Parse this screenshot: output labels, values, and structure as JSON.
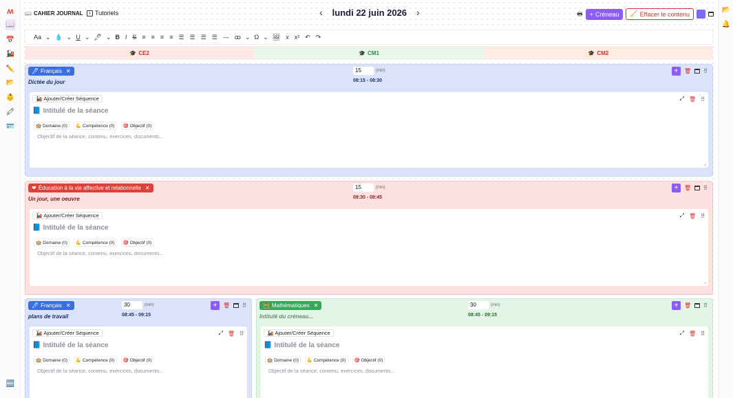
{
  "app": {
    "title": "CAHIER JOURNAL",
    "tutorials": "Tutoriels"
  },
  "nav": {
    "date": "lundi 22 juin 2026",
    "prev": "‹",
    "next": "›"
  },
  "actions": {
    "creneau": "Créneau",
    "effacer": "Effacer le contenu"
  },
  "toolbar": [
    "Aa",
    "💧",
    "U",
    "🖊",
    "B",
    "I",
    "S",
    "≡",
    "≡",
    "≡",
    "≡",
    "☰",
    "☰",
    "☰",
    "☰",
    "—",
    "ꝏ",
    "Ω",
    "🖼",
    "x",
    "x²",
    "↶",
    "↷"
  ],
  "levels": [
    {
      "label": "CE2",
      "color": "#c0392b",
      "bg": "#fde8e8"
    },
    {
      "label": "CM1",
      "color": "#2e8b57",
      "bg": "#e8f6ec"
    },
    {
      "label": "CM2",
      "color": "#c0392b",
      "bg": "#fdebe4"
    }
  ],
  "common": {
    "seq_label": "Ajouter/Créer Séquence",
    "title_placeholder": "Intitulé de la séance",
    "domaine": "Domaine (0)",
    "competence": "Compétence (0)",
    "objectif": "Objectif (0)",
    "content_placeholder": "Objectif de la séance, contenu, exercices, documents...",
    "unit": "(min)"
  },
  "slots": [
    {
      "subject": "Français",
      "subtitle": "Dictée du jour",
      "duration": "15",
      "time": "08:15 - 08:30"
    },
    {
      "subject": "Éducation à la vie affective et relationnelle",
      "subtitle": "Un jour, une oeuvre",
      "duration": "15",
      "time": "08:30 - 08:45"
    },
    {
      "subject": "Français",
      "subtitle": "plans de travail",
      "duration": "30",
      "time": "08:45 - 09:15"
    },
    {
      "subject": "Mathématiques",
      "subtitle": "Intitulé du créneau...",
      "duration": "30",
      "time": "08:45 - 09:15"
    }
  ],
  "colors": {
    "blue": "#dbe3fb",
    "blue_tag": "#3b6fe0",
    "red": "#fde0e0",
    "red_tag": "#e0403a",
    "green": "#e3f5e6",
    "green_tag": "#3aa55a",
    "purple": "#8b5cf6"
  }
}
